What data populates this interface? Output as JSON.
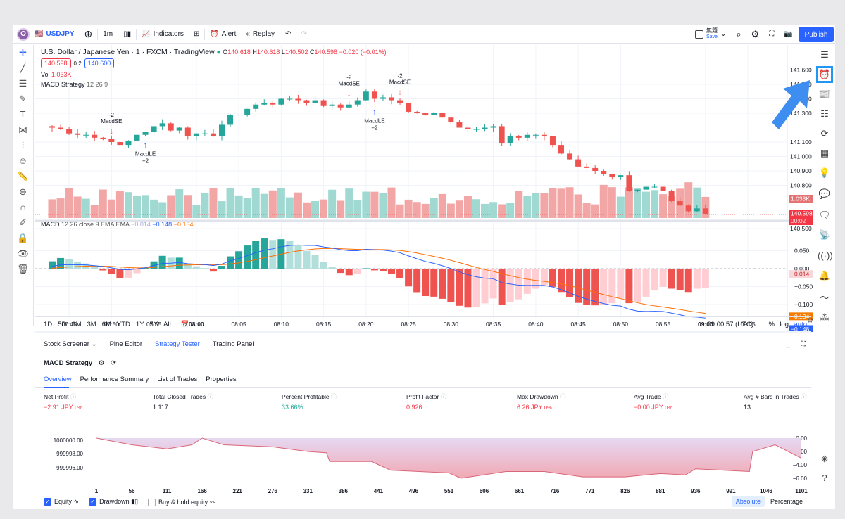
{
  "toolbar": {
    "logo": "O",
    "symbol": "USDJPY",
    "interval": "1m",
    "indicators": "Indicators",
    "alert": "Alert",
    "replay": "Replay",
    "layout_name": "無題",
    "save": "Save",
    "publish": "Publish"
  },
  "legend": {
    "title": "U.S. Dollar / Japanese Yen · 1 · FXCM · TradingView",
    "o": "140.618",
    "h": "140.618",
    "l": "140.502",
    "c": "140.598",
    "change": "−0.020 (−0.01%)",
    "bid": "140.598",
    "spread": "0.2",
    "ask": "140.600",
    "vol_label": "Vol",
    "vol": "1.033K",
    "strategy": "MACD Strategy",
    "strategy_params": "12 26 9",
    "macd_label": "MACD",
    "macd_params": "12 26 close 9 EMA EMA",
    "macd_hist": "−0.014",
    "macd_line": "−0.148",
    "macd_signal": "−0.134"
  },
  "signals": [
    {
      "label": "MacdSE",
      "qty": "-2"
    },
    {
      "label": "MacdLE",
      "qty": "+2"
    },
    {
      "label": "MacdSE",
      "qty": "-2"
    },
    {
      "label": "MacdLE",
      "qty": "+2"
    },
    {
      "label": "MacdSE",
      "qty": "-2"
    }
  ],
  "price_axis": [
    "141.600",
    "141.500",
    "141.400",
    "141.300",
    "141.100",
    "141.000",
    "140.900",
    "140.800",
    "140.500"
  ],
  "price_tags": {
    "volume": "1.033K",
    "last": "140.598",
    "countdown": "00:02"
  },
  "macd_axis": [
    "0.050",
    "0.000",
    "−0.050",
    "−0.100"
  ],
  "macd_tags": {
    "hist": "−0.014",
    "signal": "−0.134",
    "macd": "−0.148"
  },
  "time_axis": [
    "07:45",
    "07:50",
    "07:55",
    "08:00",
    "08:05",
    "08:10",
    "08:15",
    "08:20",
    "08:25",
    "08:30",
    "08:35",
    "08:40",
    "08:45",
    "08:50",
    "08:55",
    "09:00",
    "09:05"
  ],
  "ranges": [
    "1D",
    "5D",
    "1M",
    "3M",
    "6M",
    "YTD",
    "1Y",
    "5Y",
    "All"
  ],
  "clock": "09:00:57 (UTC)",
  "scale": {
    "percent": "%",
    "log": "log",
    "auto": "auto"
  },
  "colors": {
    "up": "#26a69a",
    "down": "#ef5350",
    "accent": "#2962ff",
    "macd": "#2962ff",
    "signal": "#ff6d00"
  },
  "closes": [
    141.2,
    141.19,
    141.16,
    141.15,
    141.15,
    141.13,
    141.12,
    141.1,
    141.08,
    141.11,
    141.15,
    141.17,
    141.21,
    141.23,
    141.18,
    141.2,
    141.14,
    141.16,
    141.16,
    141.14,
    141.22,
    141.29,
    141.29,
    141.33,
    141.36,
    141.37,
    141.36,
    141.4,
    141.4,
    141.39,
    141.37,
    141.39,
    141.35,
    141.36,
    141.34,
    141.36,
    141.39,
    141.45,
    141.4,
    141.41,
    141.39,
    141.37,
    141.31,
    141.3,
    141.29,
    141.3,
    141.27,
    141.24,
    141.2,
    141.19,
    141.19,
    141.2,
    141.21,
    141.09,
    141.14,
    141.13,
    141.15,
    141.15,
    141.14,
    141.08,
    141.02,
    140.98,
    140.93,
    140.92,
    140.9,
    140.88,
    140.86,
    140.87,
    140.76,
    140.77,
    140.79,
    140.79,
    140.76,
    140.69,
    140.66,
    140.62,
    140.64,
    140.598
  ],
  "panel": {
    "tabs": [
      "Stock Screener",
      "Pine Editor",
      "Strategy Tester",
      "Trading Panel"
    ],
    "strategy": "MACD Strategy",
    "subtabs": [
      "Overview",
      "Performance Summary",
      "List of Trades",
      "Properties"
    ],
    "metrics": [
      {
        "label": "Net Profit",
        "value": "−2.91 JPY",
        "pct": "0%"
      },
      {
        "label": "Total Closed Trades",
        "value": "1 117",
        "pct": ""
      },
      {
        "label": "Percent Profitable",
        "value": "33.66%",
        "pct": ""
      },
      {
        "label": "Profit Factor",
        "value": "0.926",
        "pct": ""
      },
      {
        "label": "Max Drawdown",
        "value": "6.26 JPY",
        "pct": "0%"
      },
      {
        "label": "Avg Trade",
        "value": "−0.00 JPY",
        "pct": "0%"
      },
      {
        "label": "Avg # Bars in Trades",
        "value": "13",
        "pct": ""
      }
    ],
    "equity_axis": [
      "1000000.00",
      "999998.00",
      "999996.00"
    ],
    "drawdown_axis": [
      "0.00",
      "−2.00",
      "−4.00",
      "−6.00"
    ],
    "trade_axis": [
      "1",
      "56",
      "111",
      "166",
      "221",
      "276",
      "331",
      "386",
      "441",
      "496",
      "551",
      "606",
      "661",
      "716",
      "771",
      "826",
      "881",
      "936",
      "991",
      "1046",
      "1101"
    ],
    "drawdown_curve": [
      [
        1,
        0
      ],
      [
        56,
        -1
      ],
      [
        111,
        -1.6
      ],
      [
        150,
        -1
      ],
      [
        166,
        0
      ],
      [
        200,
        -1
      ],
      [
        276,
        -1.3
      ],
      [
        331,
        -2
      ],
      [
        360,
        -2.2
      ],
      [
        365,
        -3.5
      ],
      [
        430,
        -3.5
      ],
      [
        460,
        -4.8
      ],
      [
        551,
        -5.2
      ],
      [
        570,
        -6
      ],
      [
        640,
        -5
      ],
      [
        700,
        -5
      ],
      [
        760,
        -5.8
      ],
      [
        826,
        -5.8
      ],
      [
        881,
        -5.3
      ],
      [
        920,
        -5.5
      ],
      [
        936,
        -4.6
      ],
      [
        1020,
        -5
      ],
      [
        1025,
        -2
      ],
      [
        1060,
        -1
      ],
      [
        1101,
        -3
      ]
    ],
    "toggles": [
      {
        "label": "Equity",
        "checked": true
      },
      {
        "label": "Drawdown",
        "checked": true
      },
      {
        "label": "Buy & hold equity",
        "checked": false
      }
    ],
    "mode": [
      "Absolute",
      "Percentage"
    ]
  }
}
